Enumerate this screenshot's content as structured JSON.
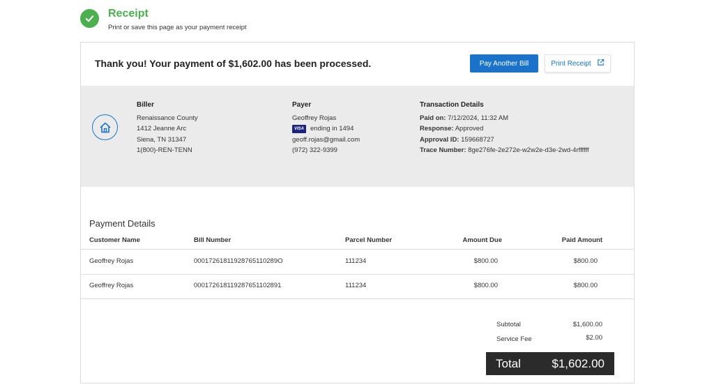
{
  "header": {
    "title": "Receipt",
    "subtitle": "Print or save this page as your payment receipt"
  },
  "top": {
    "thanks_message": "Thank you! Your payment of $1,602.00 has been processed.",
    "pay_another_label": "Pay Another Bill",
    "print_label": "Print Receipt"
  },
  "biller": {
    "title": "Biller",
    "name": "Renaissance County",
    "address1": "1412 Jeanne Arc",
    "address2": "Siena, TN 31347",
    "phone": "1(800)-REN-TENN"
  },
  "payer": {
    "title": "Payer",
    "name": "Geoffrey Rojas",
    "card_brand": "VISA",
    "card_text": "ending in 1494",
    "email": "geoff.rojas@gmail.com",
    "phone": "(972) 322-9399"
  },
  "transaction": {
    "title": "Transaction Details",
    "paid_on_label": "Paid on:",
    "paid_on": "7/12/2024, 11:32 AM",
    "response_label": "Response:",
    "response": "Approved",
    "approval_label": "Approval ID:",
    "approval_id": "159668727",
    "trace_label": "Trace Number:",
    "trace_number": "8ge276fe-2e272e-w2w2e-d3e-2wd-4rffffff"
  },
  "payment_details": {
    "title": "Payment Details",
    "columns": [
      "Customer Name",
      "Bill Number",
      "Parcel Number",
      "Amount Due",
      "Paid Amount"
    ],
    "rows": [
      [
        "Geoffrey Rojas",
        "00017261811928765110289O",
        "111234",
        "$800.00",
        "$800.00"
      ],
      [
        "Geoffrey Rojas",
        "000172618119287651102891",
        "111234",
        "$800.00",
        "$800.00"
      ]
    ]
  },
  "totals": {
    "subtotal_label": "Subtotal",
    "subtotal": "$1,600.00",
    "fee_label": "Service Fee",
    "fee": "$2.00",
    "total_label": "Total",
    "total": "$1,602.00"
  },
  "colors": {
    "success": "#4caf50",
    "accent": "#1a73c9",
    "band": "#ebebeb",
    "total_box": "#2b2b2b"
  },
  "icons": [
    "check-icon",
    "external-link-icon",
    "house-icon"
  ]
}
